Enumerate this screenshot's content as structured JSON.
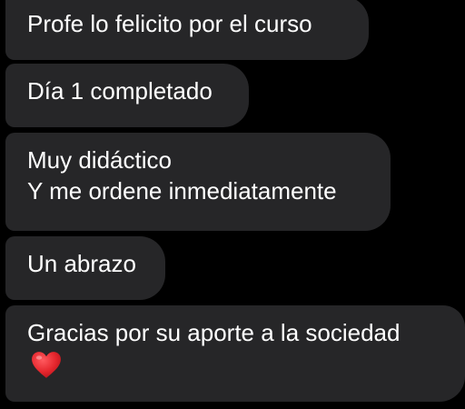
{
  "messages": [
    {
      "lines": [
        "Profe lo felicito por el curso"
      ]
    },
    {
      "lines": [
        "Día 1 completado"
      ]
    },
    {
      "lines": [
        "Muy didáctico",
        "Y me ordene inmediatamente"
      ]
    },
    {
      "lines": [
        "Un abrazo"
      ]
    },
    {
      "lines": [
        "Gracias por su aporte a la sociedad"
      ],
      "emoji": "red-heart-icon"
    }
  ],
  "colors": {
    "background": "#000000",
    "bubble": "#262628",
    "text": "#ffffff",
    "heart": "#e5262d"
  }
}
